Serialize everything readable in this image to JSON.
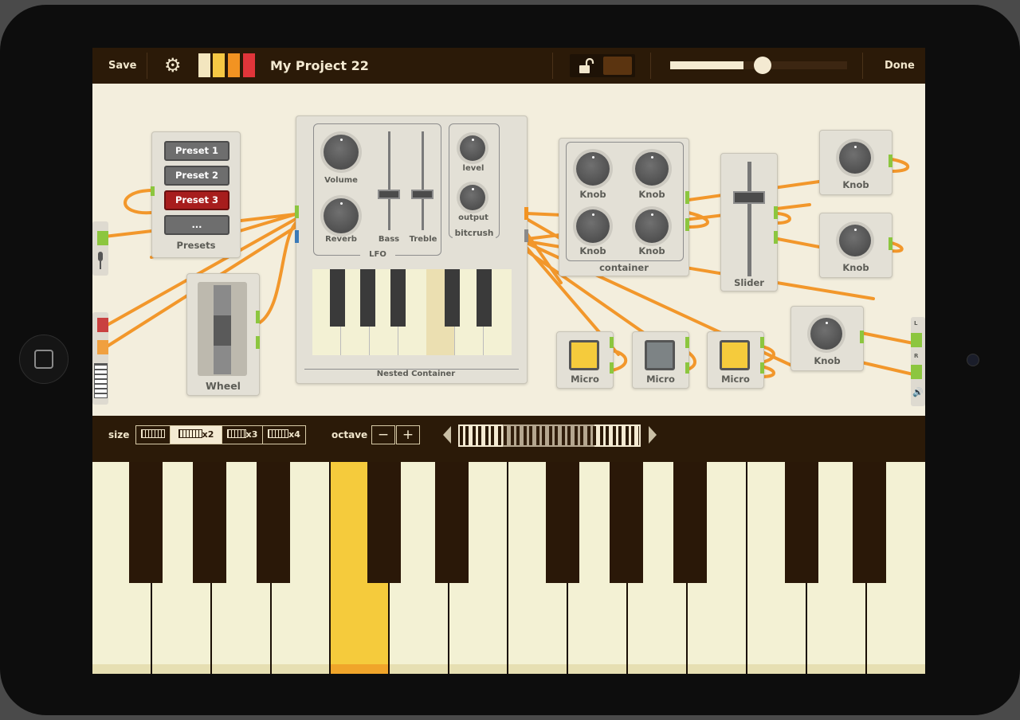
{
  "topbar": {
    "save_label": "Save",
    "project_title": "My Project 22",
    "done_label": "Done",
    "swatches": [
      "#f3e6bf",
      "#f6c844",
      "#f29322",
      "#e0353a"
    ],
    "volume_level": 0.55
  },
  "modules": {
    "presets": {
      "buttons": [
        "Preset 1",
        "Preset 2",
        "Preset 3",
        "..."
      ],
      "selected": "Preset 3",
      "label": "Presets"
    },
    "wheel": {
      "label": "Wheel"
    },
    "nested": {
      "knob_volume": "Volume",
      "knob_reverb": "Reverb",
      "slider_bass": "Bass",
      "slider_treble": "Treble",
      "lfo": "LFO",
      "knob_level": "level",
      "knob_output": "output",
      "bitcrush": "bitcrush",
      "label": "Nested Container"
    },
    "container": {
      "knobs": [
        "Knob",
        "Knob",
        "Knob",
        "Knob"
      ],
      "label": "container"
    },
    "slider": {
      "label": "Slider"
    },
    "knob_right_1": "Knob",
    "knob_right_2": "Knob",
    "knob_right_3": "Knob",
    "micros": [
      "Micro",
      "Micro",
      "Micro"
    ],
    "output_labels": {
      "left": "L",
      "right": "R"
    }
  },
  "ctrlbar": {
    "size_label": "size",
    "size_options": [
      "",
      "x2",
      "x3",
      "x4"
    ],
    "size_selected": "x2",
    "octave_label": "octave",
    "octave_minus": "−",
    "octave_plus": "+"
  },
  "colors": {
    "accent": "#f29322",
    "brand_dark": "#2b1a08",
    "active_key": "#f5cb3c",
    "port": "#8cc63f"
  }
}
